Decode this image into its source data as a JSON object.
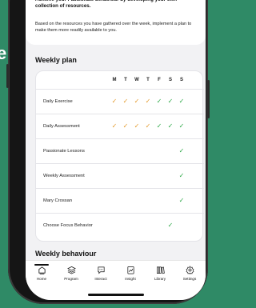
{
  "background_text": [
    "e"
  ],
  "colors": {
    "orange_check": "#e39a2c",
    "green_check": "#2aa745",
    "brand_bg": "#2f8a66"
  },
  "intro": {
    "bold_text": "Achieve your Passionate behaviour by developing your own collection of resources.",
    "body_text": "Based on the resources you have gathered over the week, implement a plan to make them more readily available to you."
  },
  "weekly_plan": {
    "title": "Weekly plan",
    "days": [
      "M",
      "T",
      "W",
      "T",
      "F",
      "S",
      "S"
    ],
    "rows": [
      {
        "label": "Daily Exercise",
        "checks": [
          "orange",
          "orange",
          "orange",
          "orange",
          "green",
          "green",
          "green"
        ]
      },
      {
        "label": "Daily Assessment",
        "checks": [
          "orange",
          "orange",
          "orange",
          "orange",
          "green",
          "green",
          "green"
        ]
      },
      {
        "label": "Passionate Lessons",
        "checks": [
          "",
          "",
          "",
          "",
          "",
          "",
          "green"
        ]
      },
      {
        "label": "Weekly Assessment",
        "checks": [
          "",
          "",
          "",
          "",
          "",
          "",
          "green"
        ]
      },
      {
        "label": "Mary Crossan",
        "checks": [
          "",
          "",
          "",
          "",
          "",
          "",
          "green"
        ]
      },
      {
        "label": "Choose Focus Behavior",
        "checks": [
          "",
          "",
          "",
          "",
          "",
          "green",
          ""
        ]
      }
    ]
  },
  "weekly_behaviour": {
    "title": "Weekly behaviour"
  },
  "tabbar": {
    "items": [
      {
        "label": "Home",
        "icon": "home-icon"
      },
      {
        "label": "Program",
        "icon": "layers-icon"
      },
      {
        "label": "Interact",
        "icon": "chat-icon"
      },
      {
        "label": "Insight",
        "icon": "clipboard-chart-icon"
      },
      {
        "label": "Library",
        "icon": "books-icon"
      },
      {
        "label": "Settings",
        "icon": "gear-icon"
      }
    ]
  }
}
